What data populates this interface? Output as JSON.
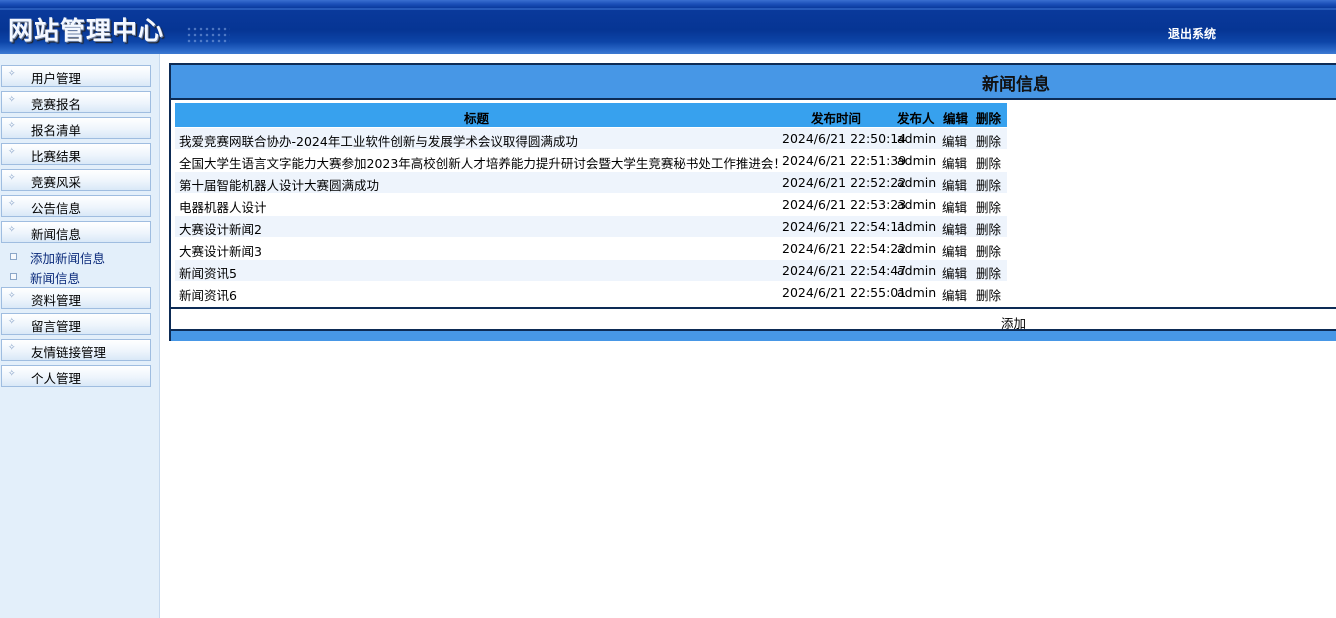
{
  "header": {
    "title": "网站管理中心",
    "logout": "退出系统"
  },
  "sidebar": {
    "items": [
      {
        "label": "用户管理"
      },
      {
        "label": "竞赛报名"
      },
      {
        "label": "报名清单"
      },
      {
        "label": "比赛结果"
      },
      {
        "label": "竞赛风采"
      },
      {
        "label": "公告信息"
      },
      {
        "label": "新闻信息"
      },
      {
        "label": "资料管理"
      },
      {
        "label": "留言管理"
      },
      {
        "label": "友情链接管理"
      },
      {
        "label": "个人管理"
      }
    ],
    "subitems": [
      {
        "label": "添加新闻信息"
      },
      {
        "label": "新闻信息"
      }
    ]
  },
  "main": {
    "title": "新闻信息",
    "columns": [
      "标题",
      "发布时间",
      "发布人",
      "编辑",
      "删除"
    ],
    "rows": [
      {
        "title": "我爱竞赛网联合协办-2024年工业软件创新与发展学术会议取得圆满成功",
        "time": "2024/6/21 22:50:14",
        "author": "admin",
        "edit": "编辑",
        "delete": "删除"
      },
      {
        "title": "全国大学生语言文字能力大赛参加2023年高校创新人才培养能力提升研讨会暨大学生竞赛秘书处工作推进会！",
        "time": "2024/6/21 22:51:39",
        "author": "admin",
        "edit": "编辑",
        "delete": "删除"
      },
      {
        "title": "第十届智能机器人设计大赛圆满成功",
        "time": "2024/6/21 22:52:22",
        "author": "admin",
        "edit": "编辑",
        "delete": "删除"
      },
      {
        "title": "电器机器人设计",
        "time": "2024/6/21 22:53:23",
        "author": "admin",
        "edit": "编辑",
        "delete": "删除"
      },
      {
        "title": "大赛设计新闻2",
        "time": "2024/6/21 22:54:11",
        "author": "admin",
        "edit": "编辑",
        "delete": "删除"
      },
      {
        "title": "大赛设计新闻3",
        "time": "2024/6/21 22:54:22",
        "author": "admin",
        "edit": "编辑",
        "delete": "删除"
      },
      {
        "title": "新闻资讯5",
        "time": "2024/6/21 22:54:47",
        "author": "admin",
        "edit": "编辑",
        "delete": "删除"
      },
      {
        "title": "新闻资讯6",
        "time": "2024/6/21 22:55:01",
        "author": "admin",
        "edit": "编辑",
        "delete": "删除"
      }
    ],
    "add_label": "添加"
  },
  "colors": {
    "banner": "#063594",
    "header_blue": "#4797e6",
    "thead_blue": "#37a1ee",
    "border_navy": "#0d2b55",
    "sidebar_bg": "#e3effa"
  }
}
